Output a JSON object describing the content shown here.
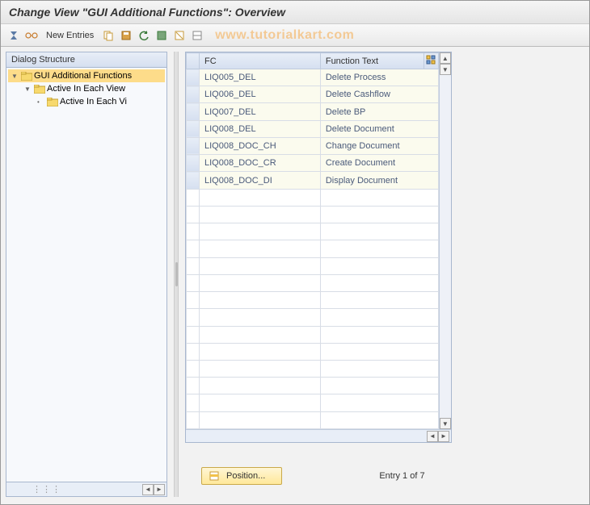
{
  "title": "Change View \"GUI Additional Functions\": Overview",
  "toolbar": {
    "new_entries_label": "New Entries"
  },
  "watermark": "www.tutorialkart.com",
  "sidebar": {
    "header": "Dialog Structure",
    "items": [
      {
        "label": "GUI Additional Functions",
        "level": 0,
        "selected": true,
        "expanded": true
      },
      {
        "label": "Active In Each View",
        "level": 1,
        "selected": false,
        "expanded": true
      },
      {
        "label": "Active In Each Vi",
        "level": 2,
        "selected": false,
        "expanded": false
      }
    ]
  },
  "table": {
    "columns": {
      "fc": "FC",
      "ft": "Function Text"
    },
    "rows": [
      {
        "fc": "LIQ005_DEL",
        "ft": "Delete Process"
      },
      {
        "fc": "LIQ006_DEL",
        "ft": "Delete Cashflow"
      },
      {
        "fc": "LIQ007_DEL",
        "ft": "Delete BP"
      },
      {
        "fc": "LIQ008_DEL",
        "ft": "Delete Document"
      },
      {
        "fc": "LIQ008_DOC_CH",
        "ft": "Change Document"
      },
      {
        "fc": "LIQ008_DOC_CR",
        "ft": "Create Document"
      },
      {
        "fc": "LIQ008_DOC_DI",
        "ft": "Display Document"
      }
    ],
    "empty_rows": 14
  },
  "footer": {
    "position_label": "Position...",
    "entry_text": "Entry 1 of 7"
  }
}
